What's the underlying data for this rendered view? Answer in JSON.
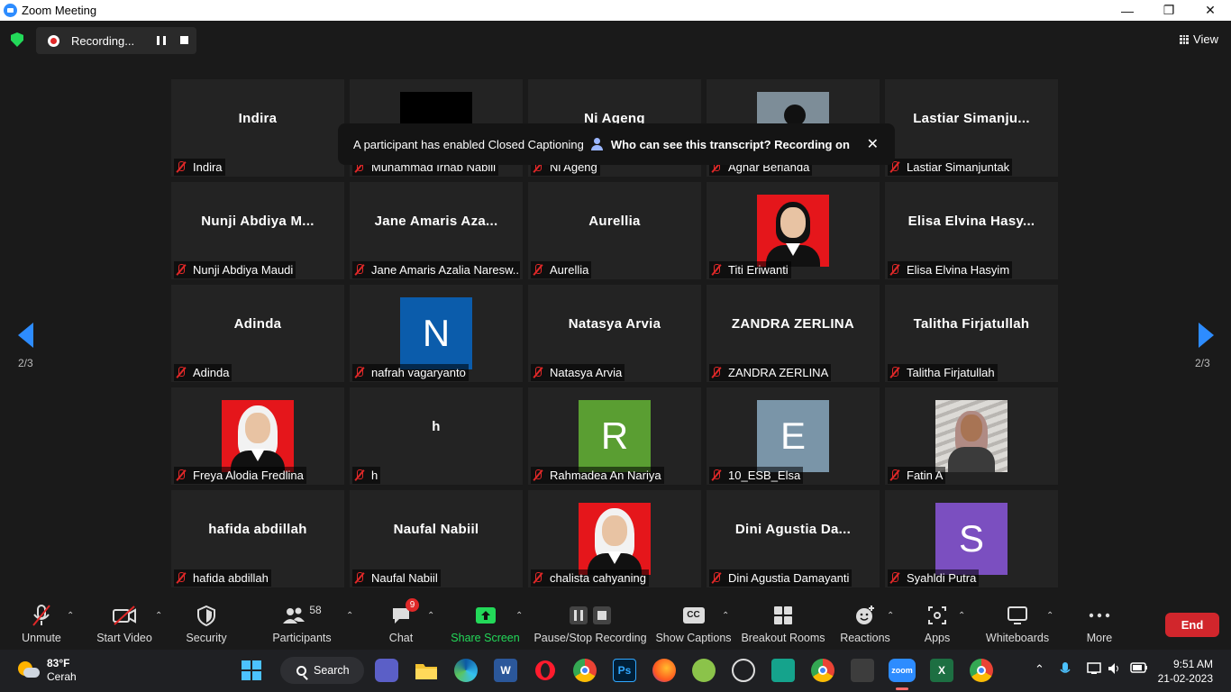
{
  "window": {
    "title": "Zoom Meeting",
    "controls": [
      "—",
      "❐",
      "✕"
    ]
  },
  "topbar": {
    "recording_label": "Recording...",
    "view_label": "View"
  },
  "banner": {
    "message": "A participant has enabled Closed Captioning",
    "link": "Who can see this transcript? Recording on",
    "close": "✕"
  },
  "pager": {
    "left": "2/3",
    "right": "2/3"
  },
  "tiles": [
    {
      "display": "Indira",
      "label": "Indira",
      "kind": "name"
    },
    {
      "display": "",
      "label": "Muhammad Irhab Nabiil",
      "kind": "black"
    },
    {
      "display": "Ni Ageng",
      "label": "Ni Ageng",
      "kind": "name"
    },
    {
      "display": "",
      "label": "Agnar Berlanda",
      "kind": "moto"
    },
    {
      "display": "Lastiar  Simanju...",
      "label": "Lastiar Simanjuntak",
      "kind": "name"
    },
    {
      "display": "Nunji  Abdiya  M...",
      "label": "Nunji Abdiya Maudi",
      "kind": "name"
    },
    {
      "display": "Jane  Amaris  Aza...",
      "label": "Jane Amaris Azalia Naresw...",
      "kind": "name"
    },
    {
      "display": "Aurellia",
      "label": "Aurellia",
      "kind": "name"
    },
    {
      "display": "",
      "label": "Titi Eriwanti",
      "kind": "redphoto"
    },
    {
      "display": "Elisa  Elvina  Hasy...",
      "label": "Elisa Elvina Hasyim",
      "kind": "name"
    },
    {
      "display": "Adinda",
      "label": "Adinda",
      "kind": "name"
    },
    {
      "display": "N",
      "label": "nafrah vagaryanto",
      "kind": "avatar",
      "color": "#0b5cab"
    },
    {
      "display": "Natasya Arvia",
      "label": "Natasya Arvia",
      "kind": "name"
    },
    {
      "display": "ZANDRA ZERLINA",
      "label": "ZANDRA ZERLINA",
      "kind": "name"
    },
    {
      "display": "Talitha Firjatullah",
      "label": "Talitha Firjatullah",
      "kind": "name"
    },
    {
      "display": "",
      "label": "Freya Alodia Fredlina",
      "kind": "hijabphoto"
    },
    {
      "display": "h",
      "label": "h",
      "kind": "name"
    },
    {
      "display": "R",
      "label": "Rahmadea An Nariya",
      "kind": "avatar",
      "color": "#5a9e32"
    },
    {
      "display": "E",
      "label": "10_ESB_Elsa",
      "kind": "avatar",
      "color": "#7a95a8"
    },
    {
      "display": "",
      "label": "Fatin A",
      "kind": "wallphoto"
    },
    {
      "display": "hafida abdillah",
      "label": "hafida abdillah",
      "kind": "name"
    },
    {
      "display": "Naufal Nabiil",
      "label": "Naufal Nabiil",
      "kind": "name"
    },
    {
      "display": "",
      "label": "chalista cahyaning",
      "kind": "hijabphoto"
    },
    {
      "display": "Dini  Agustia  Da...",
      "label": "Dini Agustia Damayanti",
      "kind": "name"
    },
    {
      "display": "S",
      "label": "Syahldi Putra",
      "kind": "avatar",
      "color": "#7b4fc0"
    }
  ],
  "toolbar": {
    "unmute": "Unmute",
    "start_video": "Start Video",
    "security": "Security",
    "participants": "Participants",
    "participants_count": "58",
    "chat": "Chat",
    "chat_badge": "9",
    "share_screen": "Share Screen",
    "pause_stop": "Pause/Stop Recording",
    "captions": "Show Captions",
    "captions_icon": "CC",
    "breakout": "Breakout Rooms",
    "reactions": "Reactions",
    "apps": "Apps",
    "whiteboards": "Whiteboards",
    "more": "More",
    "end": "End",
    "share_color": "#23d959"
  },
  "taskbar": {
    "temp": "83°F",
    "weather": "Cerah",
    "search": "Search",
    "time": "9:51 AM",
    "date": "21-02-2023",
    "apps": [
      "windows-start",
      "meet-now",
      "file-explorer",
      "edge",
      "word",
      "opera",
      "chrome",
      "photoshop",
      "firefox",
      "app-green",
      "obs",
      "app-teal",
      "chrome",
      "app-game",
      "zoom",
      "excel",
      "chrome"
    ],
    "word_glyph": "W",
    "ps_glyph": "Ps",
    "excel_glyph": "X",
    "zoom_glyph": "zoom"
  }
}
